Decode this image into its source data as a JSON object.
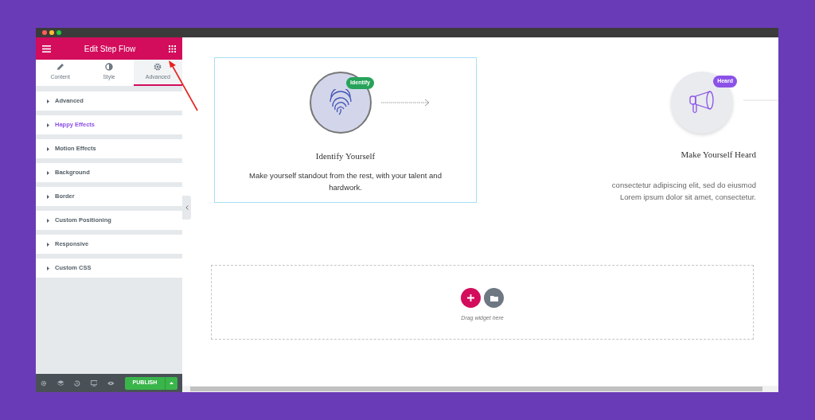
{
  "panel": {
    "title": "Edit Step Flow"
  },
  "tabs": [
    {
      "label": "Content",
      "kind": "pencil",
      "selected": false
    },
    {
      "label": "Style",
      "kind": "contrast",
      "selected": false
    },
    {
      "label": "Advanced",
      "kind": "gear",
      "selected": true
    }
  ],
  "sections": [
    {
      "label": "Advanced",
      "highlighted": false
    },
    {
      "label": "Happy Effects",
      "highlighted": true
    },
    {
      "label": "Motion Effects",
      "highlighted": false
    },
    {
      "label": "Background",
      "highlighted": false
    },
    {
      "label": "Border",
      "highlighted": false
    },
    {
      "label": "Custom Positioning",
      "highlighted": false
    },
    {
      "label": "Responsive",
      "highlighted": false
    },
    {
      "label": "Custom CSS",
      "highlighted": false
    }
  ],
  "footer": {
    "publish": "PUBLISH"
  },
  "steps": [
    {
      "kind": "fingerprint",
      "badge": "Identify",
      "color": "#27a35a",
      "title": "Identify Yourself",
      "text": "Make yourself standout from the rest, with your talent and hardwork.",
      "selected": true
    },
    {
      "kind": "megaphone",
      "badge": "Heard",
      "color": "#8c52e8",
      "title": "Make Yourself Heard",
      "text": "consectetur adipiscing elit, sed do eiusmod Lorem ipsum dolor sit amet, consectetur.",
      "selected": false
    }
  ],
  "dropzone": {
    "hint": "Drag widget here"
  }
}
